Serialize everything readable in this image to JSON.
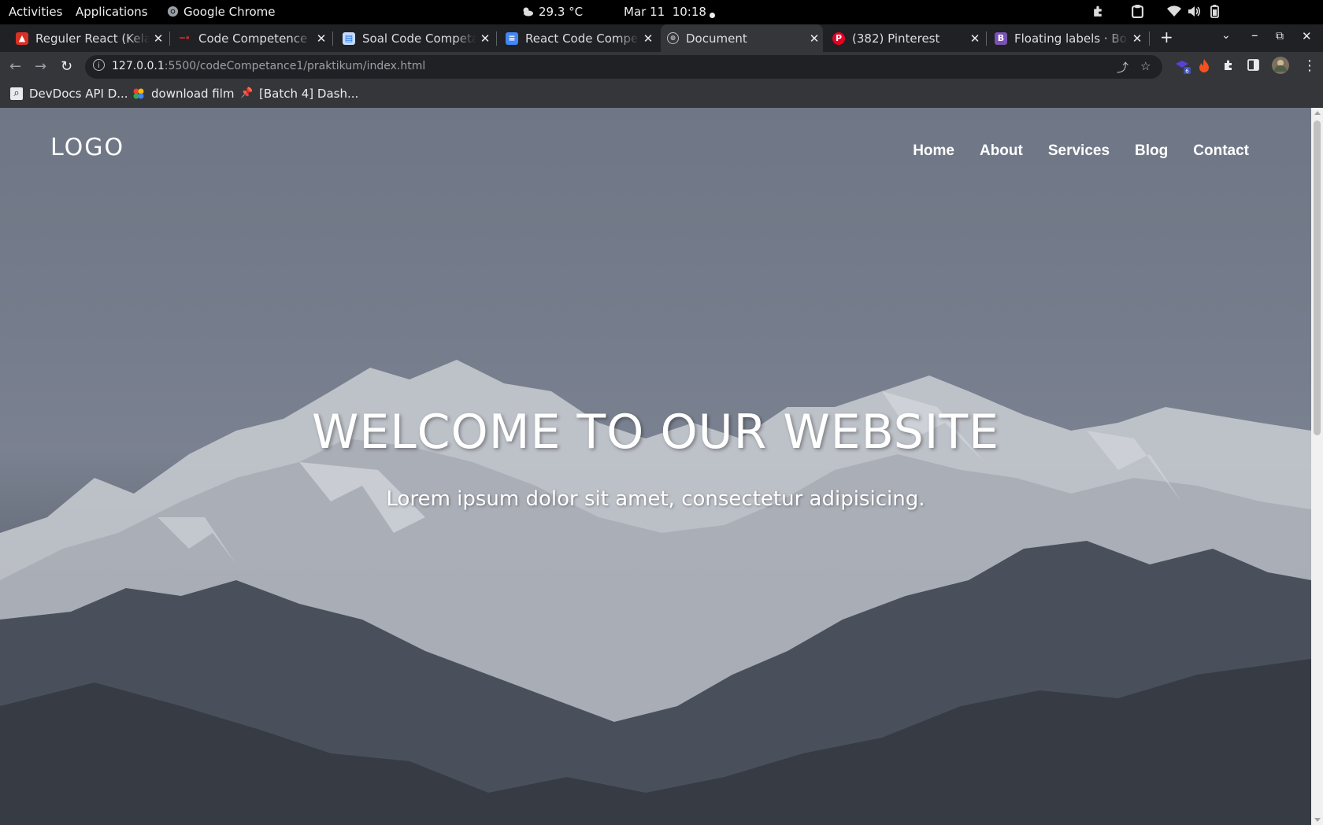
{
  "system_bar": {
    "activities": "Activities",
    "applications": "Applications",
    "app_name": "Google Chrome",
    "weather": "29.3 °C",
    "datetime": "Mar 11  10:18"
  },
  "tabs": [
    {
      "title": "Reguler React (Kelas A",
      "favicon_color": "#d93025"
    },
    {
      "title": "Code Competence KM",
      "favicon_color": "#3949ab"
    },
    {
      "title": "Soal Code Competance",
      "favicon_color": "#8ab4f8"
    },
    {
      "title": "React Code Competance",
      "favicon_color": "#4285f4"
    },
    {
      "title": "Document",
      "favicon_color": "#9aa0a6",
      "active": true
    },
    {
      "title": "(382) Pinterest",
      "favicon_color": "#e60023"
    },
    {
      "title": "Floating labels · Bootstrap",
      "favicon_color": "#7952b3"
    }
  ],
  "omnibox": {
    "host": "127.0.0.1",
    "path": ":5500/codeCompetance1/praktikum/index.html"
  },
  "extensions": {
    "badge_count": "6"
  },
  "bookmarks": [
    {
      "label": "DevDocs API D...",
      "icon": "search-icon"
    },
    {
      "label": "download film",
      "icon": "pinwheel-icon"
    },
    {
      "label": "[Batch 4] Dash...",
      "icon": "pin-icon"
    }
  ],
  "page": {
    "logo": "LOGO",
    "nav": [
      "Home",
      "About",
      "Services",
      "Blog",
      "Contact"
    ],
    "hero_title": "WELCOME TO OUR WEBSITE",
    "hero_subtitle": "Lorem ipsum dolor sit amet, consectetur adipisicing."
  },
  "colors": {
    "accent_pinterest": "#e60023",
    "accent_bootstrap": "#7952b3",
    "chrome_dark": "#202124",
    "chrome_toolbar": "#35363a"
  }
}
